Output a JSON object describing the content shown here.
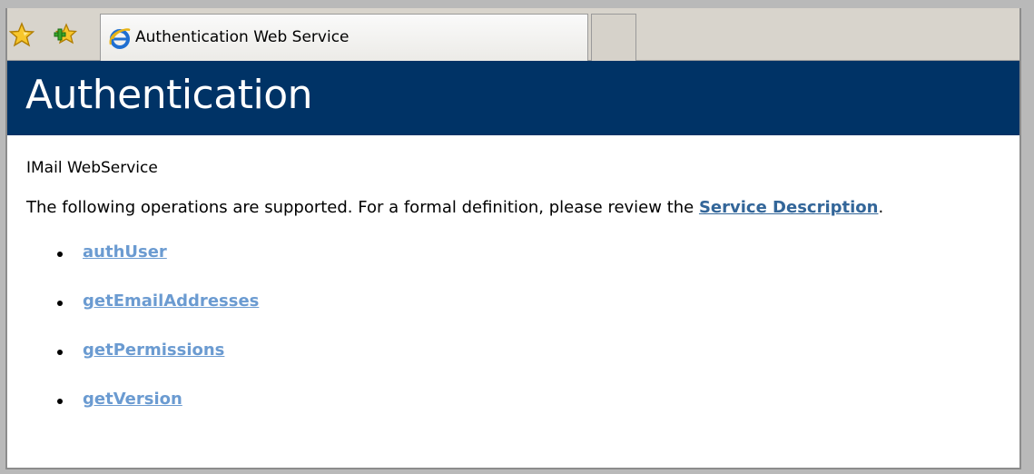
{
  "browser": {
    "tab_title": "Authentication Web Service",
    "icons": [
      "favorites-star-icon",
      "add-favorite-icon",
      "internet-explorer-icon"
    ]
  },
  "page": {
    "heading": "Authentication",
    "service_name": "IMail WebService",
    "intro_text": "The following operations are supported. For a formal definition, please review the ",
    "service_description_link": "Service Description",
    "intro_end": ".",
    "operations": [
      {
        "label": "authUser"
      },
      {
        "label": "getEmailAddresses"
      },
      {
        "label": "getPermissions"
      },
      {
        "label": "getVersion"
      }
    ]
  },
  "colors": {
    "header_bg": "#003366",
    "link": "#336699",
    "operation_link": "#6b9bd1",
    "toolbar_bg": "#d8d4cc"
  }
}
